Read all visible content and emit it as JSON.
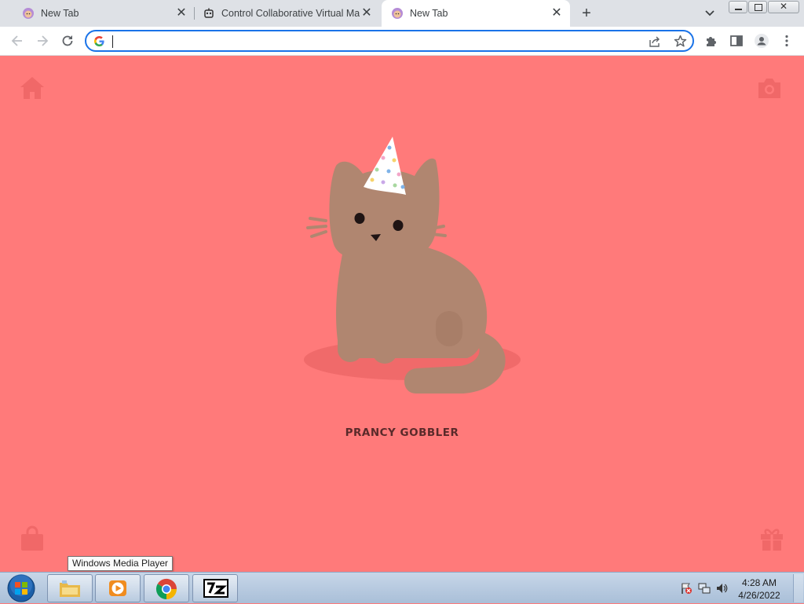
{
  "browser": {
    "tabs": [
      {
        "title": "New Tab",
        "favicon": "cat-favicon-icon",
        "active": false
      },
      {
        "title": "Control Collaborative Virtual Mac",
        "favicon": "robot-favicon-icon",
        "active": false
      },
      {
        "title": "New Tab",
        "favicon": "cat-favicon-icon",
        "active": true
      }
    ],
    "omnibox": {
      "value": "",
      "placeholder": ""
    },
    "icons": {
      "back": "arrow-left-icon",
      "forward": "arrow-right-icon",
      "reload": "reload-icon",
      "google": "google-g-icon",
      "share": "share-icon",
      "bookmark": "star-icon",
      "extensions": "puzzle-icon",
      "side_panel": "side-panel-icon",
      "profile": "profile-icon",
      "menu": "kebab-menu-icon"
    }
  },
  "page": {
    "cat_name": "PRANCY GOBBLER",
    "background_color": "#ff7a7a",
    "cat_color": "#b08670",
    "icons": {
      "top_left": "home-icon",
      "top_right": "camera-icon",
      "bottom_left": "shopping-bag-icon",
      "bottom_right": "gift-icon"
    }
  },
  "taskbar": {
    "tooltip": "Windows Media Player",
    "apps": [
      "start-orb-icon",
      "file-explorer-icon",
      "windows-media-player-icon",
      "chrome-icon",
      "7zip-icon"
    ],
    "clock": {
      "time": "4:28 AM",
      "date": "4/26/2022"
    }
  }
}
